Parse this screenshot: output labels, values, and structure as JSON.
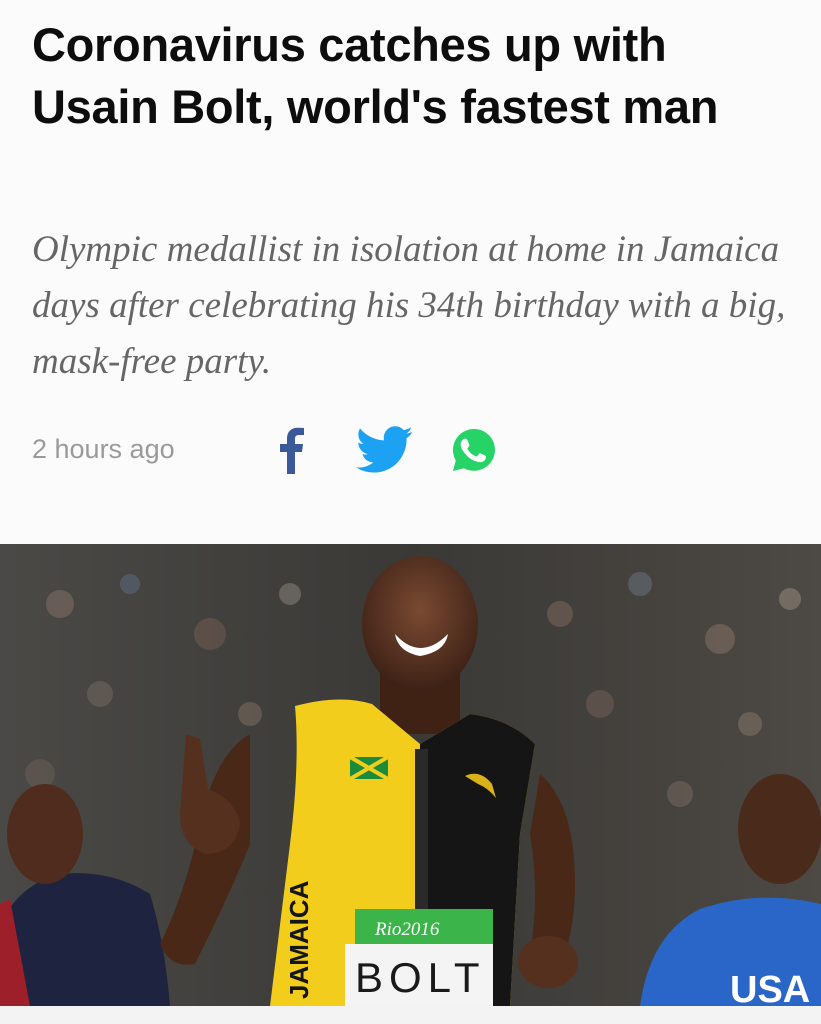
{
  "article": {
    "headline": "Coronavirus catches up with Usain Bolt, world's fastest man",
    "subheadline": "Olympic medallist in isolation at home in Jamaica days after celebrating his 34th birthday with a big, mask-free party.",
    "timestamp": "2 hours ago"
  },
  "share": {
    "facebook_icon": "facebook-icon",
    "twitter_icon": "twitter-icon",
    "whatsapp_icon": "whatsapp-icon",
    "colors": {
      "facebook": "#3b5998",
      "twitter": "#1da1f2",
      "whatsapp": "#25d366"
    }
  },
  "photo": {
    "bib_event": "Rio2016",
    "bib_name": "BOLT",
    "vest_text": "JAMAICA",
    "competitor_vest_text": "USA"
  }
}
